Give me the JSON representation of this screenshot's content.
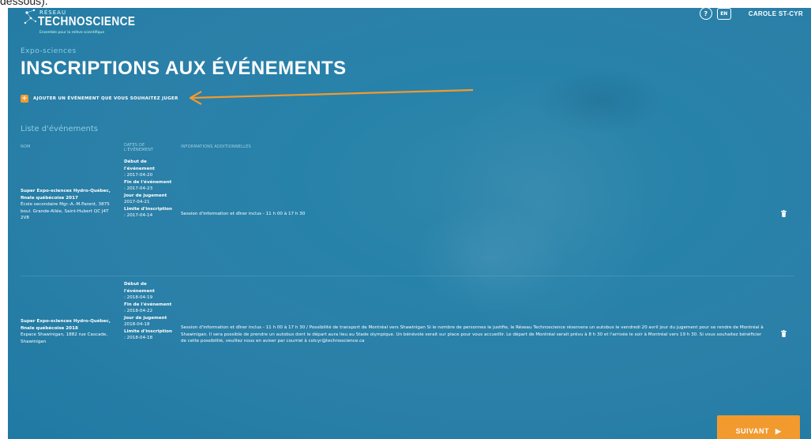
{
  "caption": "dessous).",
  "logo": {
    "small": "RÉSEAU",
    "big": "TECHNOSCIENCE",
    "tagline": "Ensemble pour la relève scientifique"
  },
  "topbar": {
    "help": "?",
    "lang": "EN",
    "user": "CAROLE ST-CYR"
  },
  "page": {
    "breadcrumb": "Expo-sciences",
    "title": "INSCRIPTIONS AUX ÉVÉNEMENTS",
    "add_event": "AJOUTER UN ÉVÉNEMENT QUE VOUS SOUHAITEZ JUGER",
    "list_title": "Liste d'événements"
  },
  "columns": {
    "name": "NOM",
    "dates_1": "DATES DE",
    "dates_2": "L'ÉVÉNEMENT",
    "info": "INFORMATIONS ADDITIONNELLES"
  },
  "events": [
    {
      "name_bold": "Super Expo-sciences Hydro-Québec, finale québécoise 2017",
      "location": "École secondaire Mgr.-A.-M.Parent, 3875 boul. Grande-Allée, Saint-Hubert QC J4T 2V8",
      "start_label": "Début de l'événement",
      "start": ": 2017-04-20",
      "end_label": "Fin de l'événement",
      "end": ": 2017-04-23",
      "judging_label": "Jour de jugement",
      "judging": "2017-04-21",
      "deadline_label": "Limite d'inscription",
      "deadline": ": 2017-04-14",
      "info": "Session d'information et dîner inclus - 11 h 00 à 17 h 30"
    },
    {
      "name_bold": "Super Expo-sciences Hydro-Québec, finale québécoise 2018",
      "location": "Espace Shawinigan, 1882 rue Cascade, Shawinigan",
      "start_label": "Début de l'événement",
      "start": ": 2018-04-19",
      "end_label": "Fin de l'événement",
      "end": ": 2018-04-22",
      "judging_label": "Jour de jugement",
      "judging": "2018-04-18",
      "deadline_label": "Limite d'inscription",
      "deadline": ": 2018-04-18",
      "info": "Session d'information et dîner inclus - 11 h 00 à 17 h 30 / Possibilité de transport de Montréal vers Shawinigan Si le nombre de personnes le justifie, le Réseau Technoscience réservera un autobus le vendredi 20 avril jour du jugement pour se rendre de Montréal à Shawinigan. Il sera possible de prendre un autobus dont le départ aura lieu au Stade olympique. Un bénévole serait sur place pour vous accueillir. Le départ de Montréal serait prévu à 8 h 30 et l'arrivée le soir à Montréal vers 19 h 30. Si vous souhaitez bénéficier de cette possibilité, veuillez nous en aviser par courriel à cstcyr@technoscience.ca"
    }
  ],
  "next_button": "SUIVANT",
  "colors": {
    "background": "#2782aa",
    "accent": "#f29a2e",
    "muted_text": "#8ccde4"
  }
}
